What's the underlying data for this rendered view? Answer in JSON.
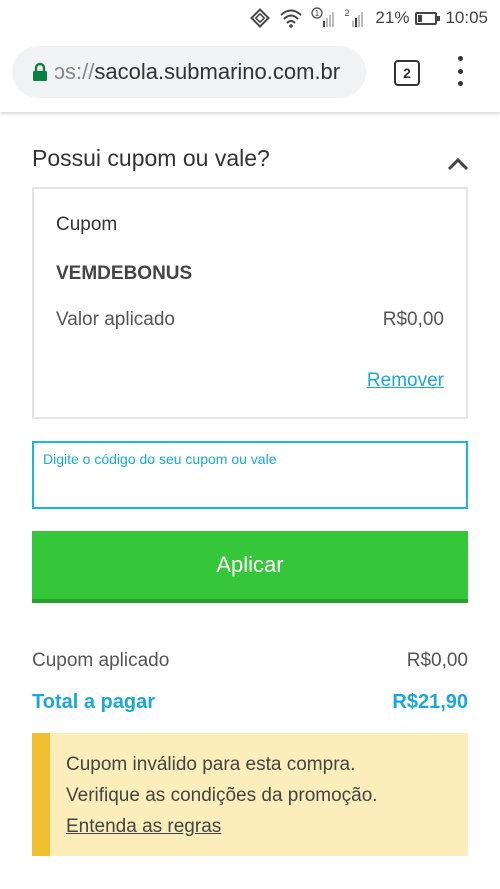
{
  "status_bar": {
    "sim1_indicator": "1",
    "sim2_indicator": "2",
    "battery_percent": "21%",
    "time": "10:05"
  },
  "browser": {
    "url_prefix": "ɔs://",
    "url_host": "sacola.submarino.com.br",
    "tab_count": "2"
  },
  "coupon_section": {
    "title": "Possui cupom ou vale?",
    "card": {
      "label": "Cupom",
      "code": "VEMDEBONUS",
      "applied_label": "Valor aplicado",
      "applied_value": "R$0,00",
      "remove_link": "Remover"
    },
    "input_label": "Digite o código do seu cupom ou vale",
    "input_value": "",
    "apply_button": "Aplicar"
  },
  "summary": {
    "coupon_label": "Cupom aplicado",
    "coupon_value": "R$0,00",
    "total_label": "Total a pagar",
    "total_value": "R$21,90"
  },
  "alert": {
    "line1": "Cupom inválido para esta compra.",
    "line2": "Verifique as condições da promoção.",
    "link": "Entenda as regras"
  },
  "colors": {
    "accent_blue": "#1ba8d8",
    "button_green": "#36c63a",
    "alert_background": "#fbeeba",
    "alert_border": "#f0c030",
    "lock_green": "#0b8043"
  },
  "icons": [
    "vibrate-icon",
    "wifi-icon",
    "signal-icon",
    "battery-icon",
    "lock-icon",
    "tab-switcher-icon",
    "more-vert-icon",
    "chevron-up-icon"
  ]
}
